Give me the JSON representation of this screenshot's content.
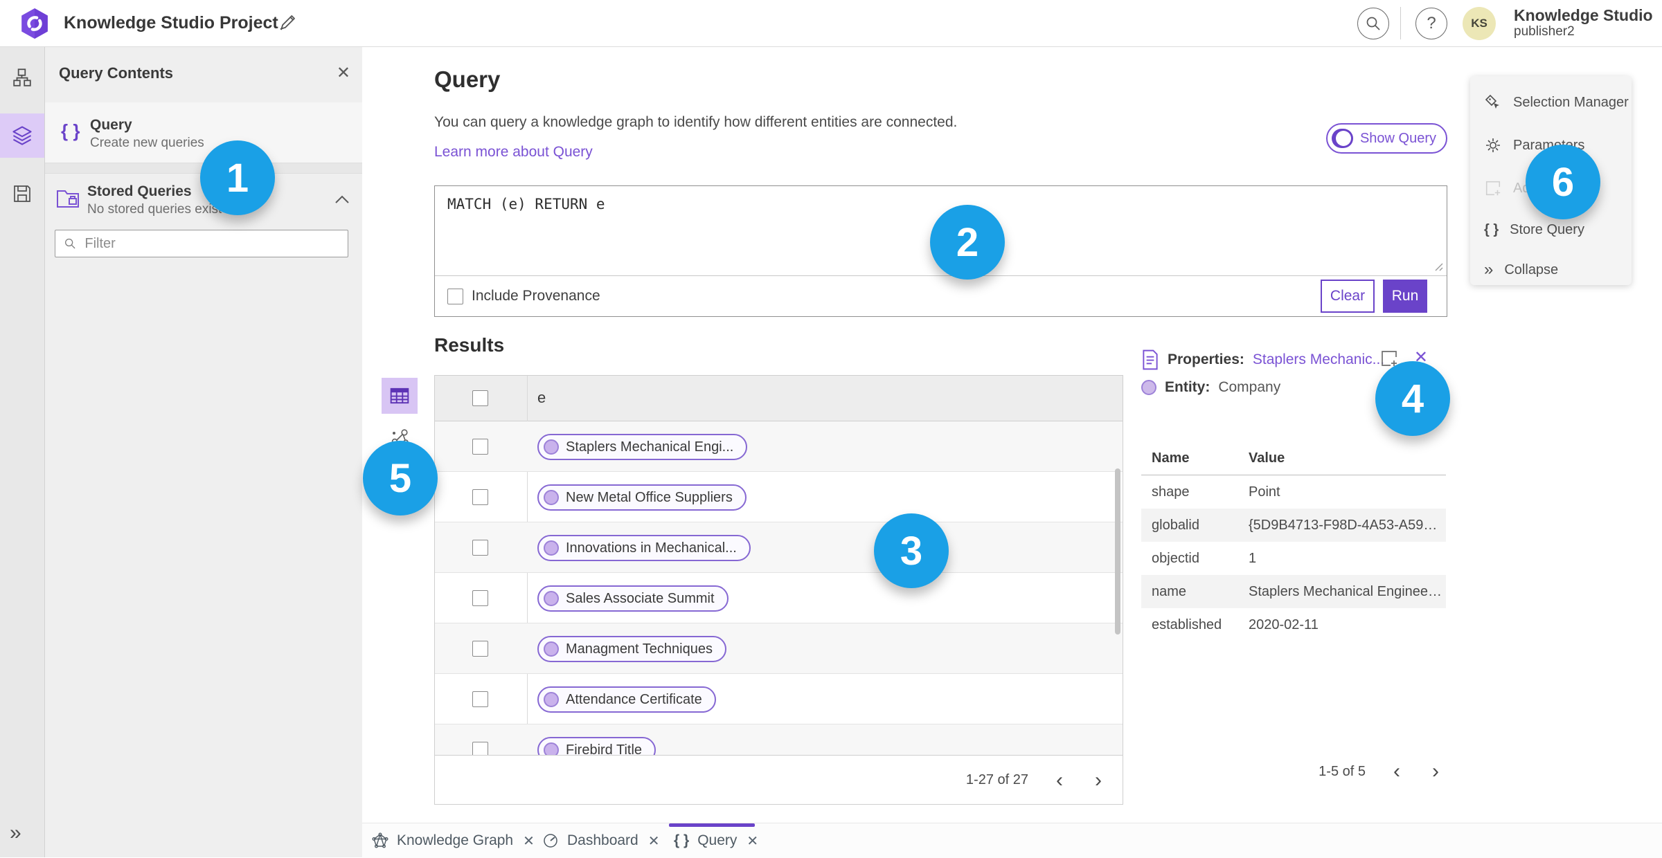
{
  "topbar": {
    "title": "Knowledge Studio Project",
    "user_name": "Knowledge Studio",
    "user_role": "publisher2",
    "avatar_initials": "KS"
  },
  "left_panel": {
    "title": "Query Contents",
    "query_item": {
      "label": "Query",
      "description": "Create new queries"
    },
    "stored_item": {
      "label": "Stored Queries",
      "description": "No stored queries exist"
    },
    "filter_placeholder": "Filter"
  },
  "query_section": {
    "title": "Query",
    "description": "You can query a knowledge graph to identify how different entities are connected.",
    "learn_more": "Learn more about Query",
    "show_query_label": "Show Query",
    "query_text": "MATCH (e) RETURN e",
    "include_provenance_label": "Include Provenance",
    "clear_label": "Clear",
    "run_label": "Run"
  },
  "results": {
    "title": "Results",
    "column_header": "e",
    "rows": [
      {
        "label": "Staplers Mechanical Engi..."
      },
      {
        "label": "New Metal Office Suppliers"
      },
      {
        "label": "Innovations in Mechanical..."
      },
      {
        "label": "Sales Associate Summit"
      },
      {
        "label": "Managment Techniques"
      },
      {
        "label": "Attendance Certificate"
      },
      {
        "label": "Firebird Title"
      }
    ],
    "pagination": {
      "range": "1-27 of 27",
      "prev": "‹",
      "next": "›"
    }
  },
  "properties_panel": {
    "header_label": "Properties:",
    "header_link": "Staplers Mechanic...",
    "entity_label": "Entity:",
    "entity_value": "Company",
    "columns": {
      "name": "Name",
      "value": "Value"
    },
    "rows": [
      {
        "name": "shape",
        "value": "Point"
      },
      {
        "name": "globalid",
        "value": "{5D9B4713-F98D-4A53-A59F-C11..."
      },
      {
        "name": "objectid",
        "value": "1"
      },
      {
        "name": "name",
        "value": "Staplers Mechanical Engineering"
      },
      {
        "name": "established",
        "value": "2020-02-11"
      }
    ],
    "pagination": {
      "range": "1-5 of 5",
      "prev": "‹",
      "next": "›"
    }
  },
  "side_menu": {
    "items": [
      {
        "label": "Selection Manager"
      },
      {
        "label": "Parameters"
      },
      {
        "label": "Ad"
      },
      {
        "label": "Store Query"
      },
      {
        "label": "Collapse"
      }
    ]
  },
  "bottom_tabs": [
    {
      "label": "Knowledge Graph",
      "close": "✕"
    },
    {
      "label": "Dashboard",
      "close": "✕"
    },
    {
      "label": "Query",
      "close": "✕"
    }
  ],
  "rail": {
    "expand": "»"
  },
  "callouts": {
    "c1": "1",
    "c2": "2",
    "c3": "3",
    "c4": "4",
    "c5": "5",
    "c6": "6"
  },
  "colors": {
    "accent_purple": "#6a43c9",
    "link_purple": "#7a52d4",
    "callout_blue": "#1aa0e6"
  }
}
